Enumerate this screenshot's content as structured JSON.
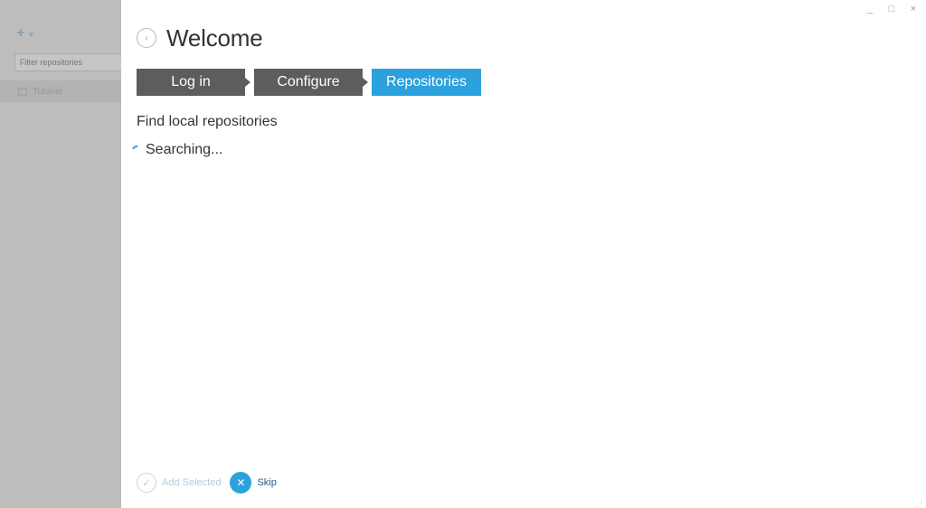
{
  "sidebar": {
    "add_icon": "plus-icon",
    "filter_placeholder": "Filter repositories",
    "items": [
      {
        "label": "Tutorial",
        "icon": "repository-icon"
      }
    ]
  },
  "window": {
    "minimize": "_",
    "maximize": "□",
    "close": "×"
  },
  "header": {
    "title": "Welcome",
    "back_icon": "chevron-left-icon"
  },
  "steps": [
    {
      "label": "Log in",
      "active": false
    },
    {
      "label": "Configure",
      "active": false
    },
    {
      "label": "Repositories",
      "active": true
    }
  ],
  "main": {
    "section_title": "Find local repositories",
    "status": "Searching..."
  },
  "footer": {
    "add_selected_label": "Add Selected",
    "skip_label": "Skip"
  },
  "colors": {
    "accent": "#2ba2dd",
    "step_inactive": "#5d5d5d",
    "sidebar_bg": "#bdbdbd"
  }
}
